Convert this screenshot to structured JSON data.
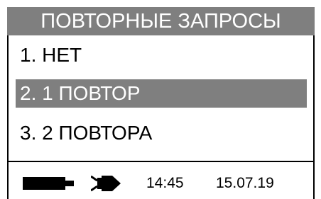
{
  "header": {
    "title": "ПОВТОРНЫЕ ЗАПРОСЫ"
  },
  "menu": {
    "items": [
      {
        "label": "1. НЕТ",
        "selected": false
      },
      {
        "label": "2. 1 ПОВТОР",
        "selected": true
      },
      {
        "label": "3. 2 ПОВТОРА",
        "selected": false
      }
    ]
  },
  "status_bar": {
    "battery_icon": "battery-icon",
    "power_icon": "power-plug-icon",
    "time": "14:45",
    "date": "15.07.19"
  },
  "colors": {
    "highlight": "#7f7f7f",
    "foreground": "#000000",
    "background": "#ffffff"
  }
}
